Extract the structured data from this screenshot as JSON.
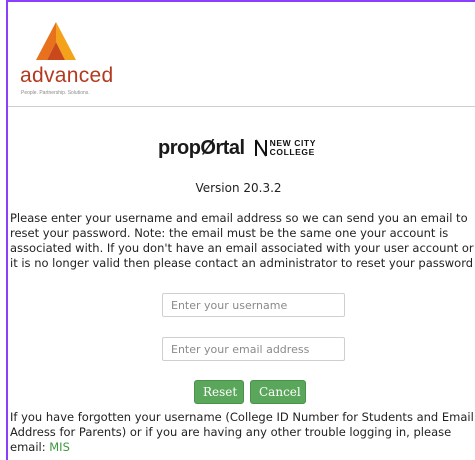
{
  "brand": {
    "logo_text": "advanced",
    "logo_tagline": "People. Partnership. Solutions.",
    "product_name": "propØrtal",
    "college_line1": "NEW CITY",
    "college_line2": "COLLEGE"
  },
  "version": "Version 20.3.2",
  "instructions": "Please enter your username and email address so we can send you an email to reset your password. Note: the email must be the same one your account is associated with. If you don't have an email associated with your user account or it is no longer valid then please contact an administrator to reset your password",
  "form": {
    "username_placeholder": "Enter your username",
    "email_placeholder": "Enter your email address",
    "reset_label": "Reset",
    "cancel_label": "Cancel"
  },
  "help": {
    "text": "If you have forgotten your username (College ID Number for Students and Email Address for Parents) or if you are having any other trouble logging in, please email: ",
    "link_text": "MIS"
  },
  "colors": {
    "accent_border": "#8a3ffc",
    "button_green": "#5aa65b",
    "link_green": "#3c9a3c",
    "logo_orange": "#e8711e"
  }
}
